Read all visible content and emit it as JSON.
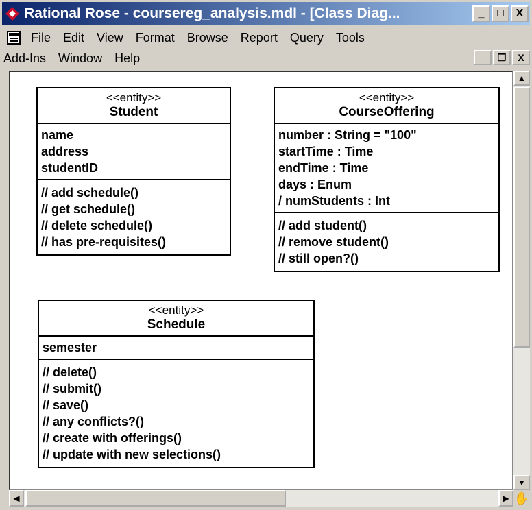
{
  "window": {
    "title": "Rational Rose - coursereg_analysis.mdl - [Class Diag...",
    "buttons": {
      "minimize": "_",
      "maximize": "□",
      "close": "X"
    },
    "mdi_buttons": {
      "minimize": "_",
      "restore": "❐",
      "close": "X"
    }
  },
  "menu": {
    "row1": [
      "File",
      "Edit",
      "View",
      "Format",
      "Browse",
      "Report",
      "Query",
      "Tools"
    ],
    "row2": [
      "Add-Ins",
      "Window",
      "Help"
    ]
  },
  "diagram": {
    "classes": [
      {
        "stereotype": "<<entity>>",
        "name": "Student",
        "attributes": [
          "name",
          "address",
          "studentID"
        ],
        "operations": [
          "// add schedule()",
          "// get schedule()",
          "// delete schedule()",
          "// has pre-requisites()"
        ]
      },
      {
        "stereotype": "<<entity>>",
        "name": "CourseOffering",
        "attributes": [
          "number : String = \"100\"",
          "startTime : Time",
          "endTime : Time",
          "days : Enum",
          "/ numStudents : Int"
        ],
        "operations": [
          "// add student()",
          "// remove student()",
          "// still open?()"
        ]
      },
      {
        "stereotype": "<<entity>>",
        "name": "Schedule",
        "attributes": [
          "semester"
        ],
        "operations": [
          "// delete()",
          "// submit()",
          "// save()",
          "// any conflicts?()",
          "// create with offerings()",
          "// update with new selections()"
        ]
      }
    ]
  },
  "colors": {
    "title_start": "#0a246a",
    "title_end": "#a6caf0",
    "chrome": "#d4d0c8"
  }
}
